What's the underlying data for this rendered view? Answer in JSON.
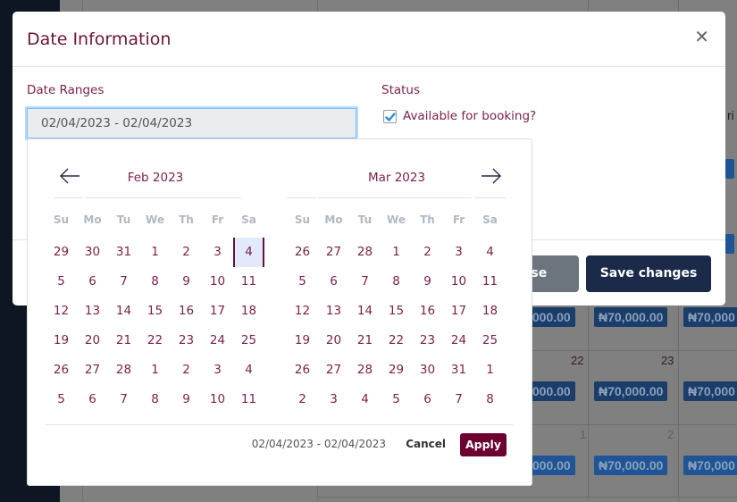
{
  "background": {
    "weekday_partial": "ri",
    "day_numbers": [
      "22",
      "23",
      "1",
      "2"
    ],
    "price_label": "₦70,000.00",
    "price_partial": ",000.00",
    "price_partial_right": "₦70,000"
  },
  "modal": {
    "title": "Date Information",
    "close_icon": "close-icon",
    "date_ranges_label": "Date Ranges",
    "date_ranges_value": "02/04/2023 - 02/04/2023",
    "status_label": "Status",
    "available_checkbox": {
      "label": "Available for booking?",
      "checked": true
    },
    "close_button": "Close",
    "save_button": "Save changes"
  },
  "datepicker": {
    "prev_icon": "arrow-left-icon",
    "next_icon": "arrow-right-icon",
    "weekdays": [
      "Su",
      "Mo",
      "Tu",
      "We",
      "Th",
      "Fr",
      "Sa"
    ],
    "calendars": [
      {
        "title": "Feb 2023",
        "weeks": [
          [
            "29",
            "30",
            "31",
            "1",
            "2",
            "3",
            "4"
          ],
          [
            "5",
            "6",
            "7",
            "8",
            "9",
            "10",
            "11"
          ],
          [
            "12",
            "13",
            "14",
            "15",
            "16",
            "17",
            "18"
          ],
          [
            "19",
            "20",
            "21",
            "22",
            "23",
            "24",
            "25"
          ],
          [
            "26",
            "27",
            "28",
            "1",
            "2",
            "3",
            "4"
          ],
          [
            "5",
            "6",
            "7",
            "8",
            "9",
            "10",
            "11"
          ]
        ],
        "selected": [
          0,
          6
        ]
      },
      {
        "title": "Mar 2023",
        "weeks": [
          [
            "26",
            "27",
            "28",
            "1",
            "2",
            "3",
            "4"
          ],
          [
            "5",
            "6",
            "7",
            "8",
            "9",
            "10",
            "11"
          ],
          [
            "12",
            "13",
            "14",
            "15",
            "16",
            "17",
            "18"
          ],
          [
            "19",
            "20",
            "21",
            "22",
            "23",
            "24",
            "25"
          ],
          [
            "26",
            "27",
            "28",
            "29",
            "30",
            "31",
            "1"
          ],
          [
            "2",
            "3",
            "4",
            "5",
            "6",
            "7",
            "8"
          ]
        ]
      }
    ],
    "selected_range_text": "02/04/2023 - 02/04/2023",
    "cancel_label": "Cancel",
    "apply_label": "Apply"
  }
}
